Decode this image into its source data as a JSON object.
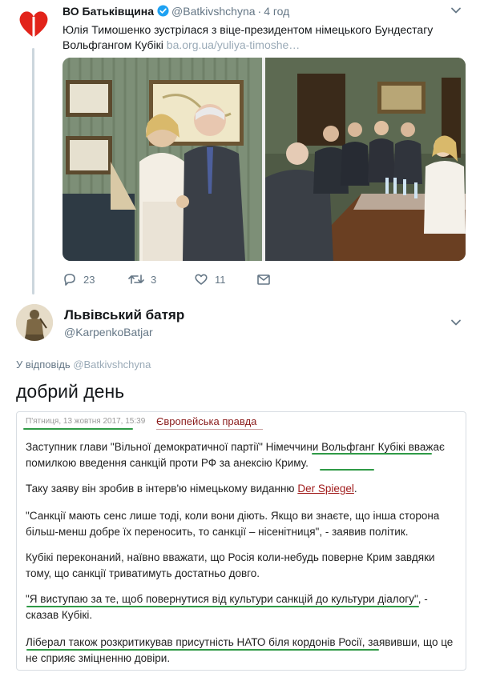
{
  "colors": {
    "accent_red": "#e2231a",
    "verified_blue": "#1da1f2",
    "muted": "#657786",
    "highlight_green": "#2f9a46",
    "source_red": "#8a1b1b"
  },
  "tweet1": {
    "name": "ВО Батьківщина",
    "handle": "@Batkivshchyna",
    "time": "4 год",
    "text": "Юлія Тимошенко зустрілася з віце-президентом німецького Бундестагу Вольфгангом Кубікі",
    "link": "ba.org.ua/yuliya-timoshe…",
    "stats": {
      "replies": "23",
      "retweets": "3",
      "likes": "11"
    }
  },
  "tweet2": {
    "name": "Львівський батяр",
    "handle": "@KarpenkoBatjar",
    "reply_prefix": "У відповідь",
    "reply_handle": "@Batkivshchyna",
    "text": "добрий день"
  },
  "article": {
    "date": "П'ятниця, 13 жовтня 2017, 15:39",
    "source": "Європейська правда",
    "p1": "Заступник глави \"Вільної демократичної партії\" Німеччини Вольфганг Кубікі вважає помилкою введення санкцій проти РФ за анексію Криму.",
    "p2_text": "Таку заяву він зробив в інтерв'ю німецькому виданню ",
    "p2_link": "Der Spiegel",
    "p2_end": ".",
    "p3": "\"Санкції мають сенс лише тоді, коли вони діють. Якщо ви знаєте, що інша сторона більш-менш добре їх переносить, то санкції – нісенітниця\", - заявив політик.",
    "p4": "Кубікі переконаний, наївно вважати, що Росія коли-небудь поверне Крим завдяки тому, що санкції триватимуть достатньо довго.",
    "p5": "\"Я виступаю за те, щоб повернутися від культури санкцій до культури діалогу\", - сказав Кубікі.",
    "p6": "Ліберал також розкритикував присутність НАТО біля кордонів Росії, заявивши, що це не сприяє зміцненню довіри."
  }
}
